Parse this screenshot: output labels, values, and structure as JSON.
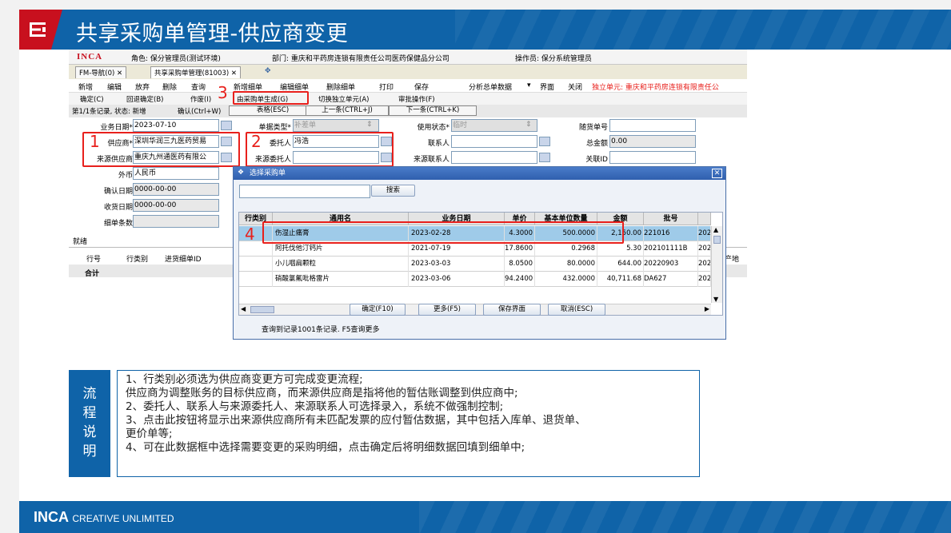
{
  "slide": {
    "title": "共享采购单管理-供应商变更",
    "footer_brand": "INCA",
    "footer_tagline": "CREATIVE UNLIMITED"
  },
  "app": {
    "brand": "INCA",
    "role": "角色: 保分管理员(测试环境)",
    "department": "部门: 重庆和平药房连锁有限责任公司医药保健品分公司",
    "operator": "操作员: 保分系统管理员",
    "tabs": [
      "FM-导航(0)",
      "共享采购单管理(81003)"
    ],
    "menu": [
      "新增",
      "编辑",
      "放弃",
      "删除",
      "查询",
      "新增细单",
      "编辑细单",
      "删除细单",
      "打印",
      "保存",
      "分析总单数据",
      "界面",
      "关闭"
    ],
    "independent_unit": "独立单元: 重庆和平药房连锁有限责任公",
    "menu2": [
      "确定(C)",
      "回退确定(B)",
      "作废(I)",
      "由采购单生成(G)",
      "切换独立单元(A)",
      "审批操作(F)"
    ],
    "status": "第1/1条记录, 状态: 新增",
    "nav_buttons": [
      "确认(Ctrl+W)",
      "表格(ESC)",
      "上一条(CTRL+J)",
      "下一条(CTRL+K)"
    ]
  },
  "form": {
    "labels": {
      "biz_date": "业务日期*",
      "supplier": "供应商*",
      "source_supplier": "来源供应商",
      "currency": "外币",
      "confirm_date": "确认日期",
      "receive_date": "收货日期",
      "detail_count": "细单条数",
      "doc_type": "单据类型*",
      "consignor": "委托人",
      "source_consignor": "来源委托人",
      "use_status": "使用状态*",
      "contact": "联系人",
      "source_contact": "来源联系人",
      "follow_no": "随货单号",
      "total": "总金额",
      "related_id": "关联ID"
    },
    "values": {
      "biz_date": "2023-07-10",
      "supplier": "深圳华润三九医药贸易",
      "source_supplier": "重庆九州通医药有限公",
      "currency": "人民币",
      "confirm_date": "0000-00-00",
      "receive_date": "0000-00-00",
      "doc_type": "补差单",
      "consignor": "冯浩",
      "use_status": "临时",
      "total": "0.00"
    },
    "grid_label": "就绪",
    "grid_headers": [
      "行号",
      "行类别",
      "进货细单ID"
    ],
    "total_row": "合计",
    "right_fragment": "产地",
    "markers": [
      "1",
      "2",
      "3",
      "4"
    ]
  },
  "dialog": {
    "title": "选择采购单",
    "search_button": "搜索",
    "columns": [
      "行类别",
      "通用名",
      "业务日期",
      "单价",
      "基本单位数量",
      "金额",
      "批号"
    ],
    "rows": [
      {
        "cat": "",
        "name": "伤湿止痛膏",
        "date": "2023-02-28",
        "price": "4.3000",
        "qty": "500.0000",
        "amount": "2,150.00",
        "lot": "221016",
        "extra": "202"
      },
      {
        "cat": "",
        "name": "阿托伐他汀钙片",
        "date": "2021-07-19",
        "price": "17.8600",
        "qty": "0.2968",
        "amount": "5.30",
        "lot": "202101111B",
        "extra": "202"
      },
      {
        "cat": "",
        "name": "小儿咽扁颗粒",
        "date": "2023-03-03",
        "price": "8.0500",
        "qty": "80.0000",
        "amount": "644.00",
        "lot": "20220903",
        "extra": "202"
      },
      {
        "cat": "",
        "name": "硝酸氯氟吡格雷片",
        "date": "2023-03-06",
        "price": "94.2400",
        "qty": "432.0000",
        "amount": "40,711.68",
        "lot": "DA627",
        "extra": "202"
      }
    ],
    "buttons": [
      "确定(F10)",
      "更多(F5)",
      "保存界面",
      "取消(ESC)"
    ],
    "status": "查询到记录1001条记录. F5查询更多"
  },
  "notes": {
    "flow_label": [
      "流",
      "程",
      "说",
      "明"
    ],
    "lines": [
      "1、行类别必须选为供应商变更方可完成变更流程;",
      "供应商为调整账务的目标供应商，而来源供应商是指将他的暂估账调整到供应商中;",
      "2、委托人、联系人与来源委托人、来源联系人可选择录入，系统不做强制控制;",
      "3、点击此按钮将显示出来源供应商所有未匹配发票的应付暂估数据，其中包括入库单、退货单、",
      "更价单等;",
      "4、可在此数据框中选择需要变更的采购明细，点击确定后将明细数据回填到细单中;"
    ]
  },
  "colors": {
    "brand_blue": "#0f63a8",
    "brand_red": "#c8101e",
    "annotation_red": "#e8201c",
    "selected_row": "#9fcbe9"
  }
}
